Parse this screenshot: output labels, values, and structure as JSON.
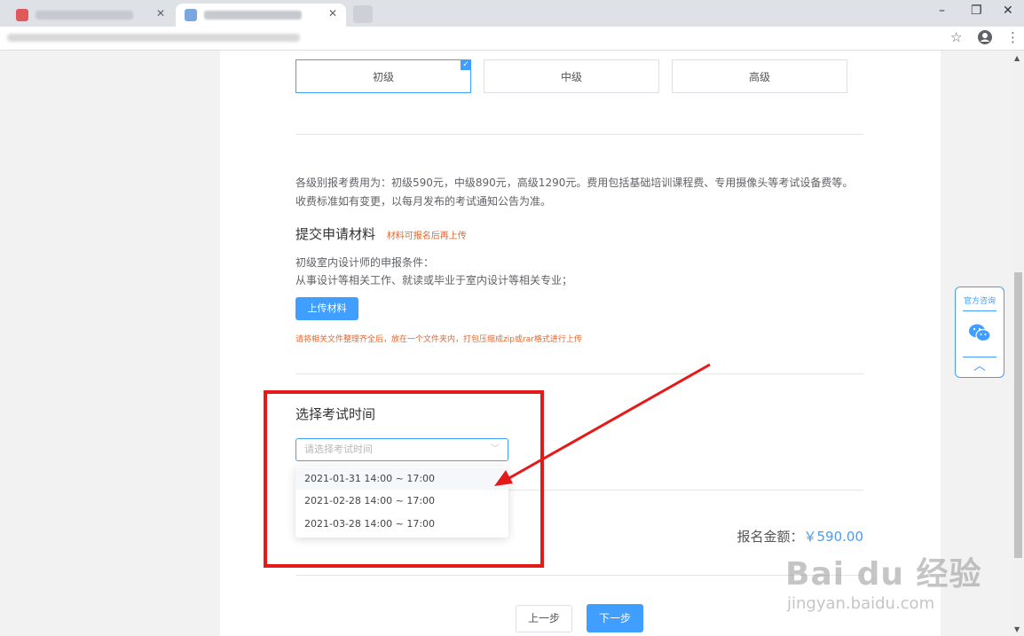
{
  "browser": {
    "window_controls": {
      "minimize": "–",
      "restore": "❐",
      "close": "✕"
    }
  },
  "levels": [
    {
      "label": "初级",
      "selected": true
    },
    {
      "label": "中级",
      "selected": false
    },
    {
      "label": "高级",
      "selected": false
    }
  ],
  "fee_description": "各级别报考费用为：初级590元，中级890元，高级1290元。费用包括基础培训课程费、专用摄像头等考试设备费等。收费标准如有变更，以每月发布的考试通知公告为准。",
  "materials": {
    "title": "提交申请材料",
    "hint": "材料可报名后再上传",
    "condition_title": "初级室内设计师的申报条件：",
    "condition_text": "从事设计等相关工作、就读或毕业于室内设计等相关专业；",
    "upload_label": "上传材料",
    "upload_hint": "请将相关文件整理齐全后，放在一个文件夹内，打包压缩成zip或rar格式进行上传"
  },
  "exam_time": {
    "title": "选择考试时间",
    "placeholder": "请选择考试时间",
    "options": [
      "2021-01-31 14:00 ~ 17:00",
      "2021-02-28 14:00 ~ 17:00",
      "2021-03-28 14:00 ~ 17:00"
    ]
  },
  "amount": {
    "label": "报名金额：",
    "value": "￥590.00"
  },
  "nav": {
    "prev": "上一步",
    "next": "下一步"
  },
  "consult": {
    "label": "官方咨询"
  },
  "watermark": {
    "brand": "Bai du 经验",
    "url": "jingyan.baidu.com"
  },
  "colors": {
    "accent": "#409eff",
    "annotation": "#e61919",
    "hint": "#e6672e"
  }
}
